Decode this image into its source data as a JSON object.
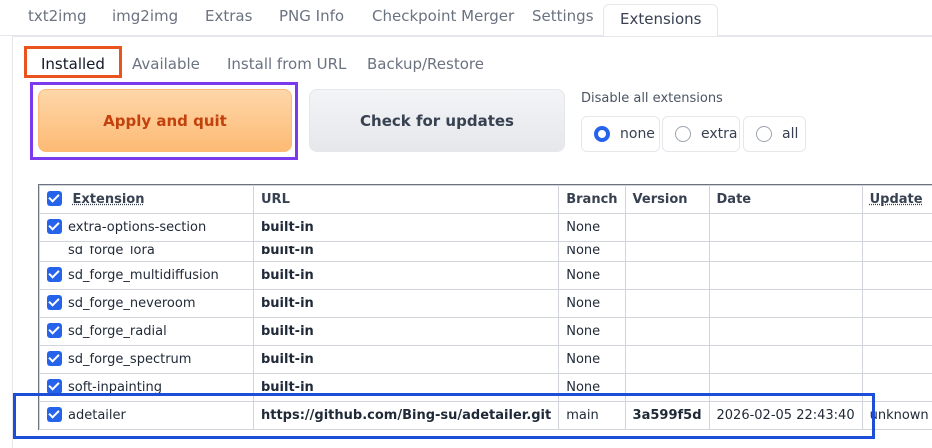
{
  "top_tabs": [
    "txt2img",
    "img2img",
    "Extras",
    "PNG Info",
    "Checkpoint Merger",
    "Settings",
    "Extensions"
  ],
  "active_top_tab": "Extensions",
  "sub_tabs": [
    "Installed",
    "Available",
    "Install from URL",
    "Backup/Restore"
  ],
  "active_sub_tab": "Installed",
  "buttons": {
    "apply": "Apply and quit",
    "check": "Check for updates"
  },
  "disable": {
    "label": "Disable all extensions",
    "options": [
      "none",
      "extra",
      "all"
    ],
    "selected": "none"
  },
  "table": {
    "headers": [
      "Extension",
      "URL",
      "Branch",
      "Version",
      "Date",
      "Update"
    ],
    "rows": [
      {
        "name": "extra-options-section",
        "url": "built-in",
        "branch": "None",
        "version": "",
        "date": "",
        "update": ""
      },
      {
        "name": "sd_forge_lora",
        "url": "built-in",
        "branch": "None",
        "version": "",
        "date": "",
        "update": ""
      },
      {
        "name": "sd_forge_multidiffusion",
        "url": "built-in",
        "branch": "None",
        "version": "",
        "date": "",
        "update": ""
      },
      {
        "name": "sd_forge_neveroom",
        "url": "built-in",
        "branch": "None",
        "version": "",
        "date": "",
        "update": ""
      },
      {
        "name": "sd_forge_radial",
        "url": "built-in",
        "branch": "None",
        "version": "",
        "date": "",
        "update": ""
      },
      {
        "name": "sd_forge_spectrum",
        "url": "built-in",
        "branch": "None",
        "version": "",
        "date": "",
        "update": ""
      },
      {
        "name": "soft-inpainting",
        "url": "built-in",
        "branch": "None",
        "version": "",
        "date": "",
        "update": ""
      },
      {
        "name": "adetailer",
        "url": "https://github.com/Bing-su/adetailer.git",
        "branch": "main",
        "version": "3a599f5d",
        "date": "2026-02-05 22:43:40",
        "update": "unknown"
      }
    ]
  },
  "colors": {
    "accent": "#2563eb",
    "apply_text": "#c2410c",
    "hl_orange": "#e8531e",
    "hl_purple": "#7c3aed",
    "hl_blue": "#1d4ed8"
  }
}
